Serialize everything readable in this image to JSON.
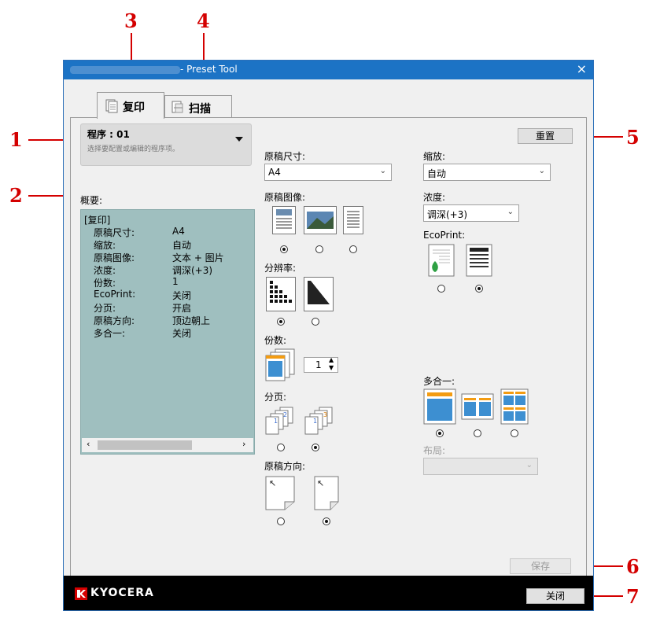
{
  "callouts": [
    "1",
    "2",
    "3",
    "4",
    "5",
    "6",
    "7"
  ],
  "window": {
    "title": "- Preset Tool",
    "close_glyph": "×"
  },
  "tabs": [
    {
      "label": "复印",
      "icon": "copy-icon",
      "active": true
    },
    {
      "label": "扫描",
      "icon": "scan-icon",
      "active": false
    }
  ],
  "program": {
    "title": "程序 : 01",
    "hint": "选择要配置或编辑的程序项。"
  },
  "summary": {
    "heading_label": "概要:",
    "section": "[复印]",
    "rows": [
      {
        "label": "原稿尺寸:",
        "value": "A4"
      },
      {
        "label": "缩放:",
        "value": "自动"
      },
      {
        "label": "原稿图像:",
        "value": "文本 + 图片"
      },
      {
        "label": "浓度:",
        "value": "调深(+3)"
      },
      {
        "label": "份数:",
        "value": "1"
      },
      {
        "label": "EcoPrint:",
        "value": "关闭"
      },
      {
        "label": "分页:",
        "value": "开启"
      },
      {
        "label": "原稿方向:",
        "value": "顶边朝上"
      },
      {
        "label": "多合一:",
        "value": "关闭"
      }
    ]
  },
  "fields": {
    "original_size_label": "原稿尺寸:",
    "original_size_value": "A4",
    "original_image_label": "原稿图像:",
    "resolution_label": "分辨率:",
    "copies_label": "份数:",
    "copies_value": "1",
    "collate_label": "分页:",
    "orientation_label": "原稿方向:",
    "zoom_label": "缩放:",
    "zoom_value": "自动",
    "density_label": "浓度:",
    "density_value": "调深(+3)",
    "ecoprint_label": "EcoPrint:",
    "combine_label": "多合一:",
    "layout_label": "布局:",
    "layout_value": ""
  },
  "selected": {
    "original_image": 0,
    "resolution": 0,
    "collate": 1,
    "orientation": 1,
    "ecoprint": 1,
    "combine": 0
  },
  "buttons": {
    "reset": "重置",
    "save": "保存",
    "close": "关闭"
  },
  "brand": "KYOCERA",
  "colors": {
    "titlebar": "#1c73c5",
    "callout": "#d40000",
    "summary_bg": "#9fbfbf",
    "footer": "#000000"
  }
}
